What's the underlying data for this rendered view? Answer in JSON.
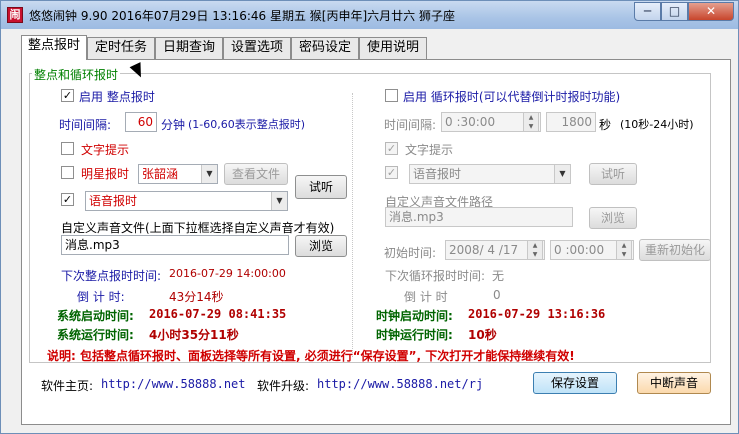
{
  "window": {
    "title": "悠悠闹钟 9.90 2016年07月29日 13:16:46 星期五 猴[丙申年]六月廿六 狮子座",
    "icon_glyph": "闹",
    "controls": {
      "minimize": "─",
      "maximize": "□",
      "close": "✕"
    }
  },
  "tabs": [
    {
      "label": "整点报时",
      "active": true
    },
    {
      "label": "定时任务"
    },
    {
      "label": "日期查询"
    },
    {
      "label": "设置选项"
    },
    {
      "label": "密码设定"
    },
    {
      "label": "使用说明"
    }
  ],
  "group_title": "整点和循环报时",
  "left": {
    "enable_label": "启用 整点报时",
    "enable_checked": "✓",
    "interval_label": "时间间隔:",
    "interval_value": "60",
    "interval_unit": "分钟",
    "interval_hint": "(1-60,60表示整点报时)",
    "text_prompt_label": "文字提示",
    "star_label": "明星报时",
    "star_select": "张韶涵",
    "view_file_label": "查看文件",
    "voice_checked": "✓",
    "voice_select": "语音报时",
    "audition_label": "试听",
    "custom_sound_label": "自定义声音文件(上面下拉框选择自定义声音才有效)",
    "custom_sound_file": "消息.mp3",
    "browse_label": "浏览",
    "next_label": "下次整点报时时间:",
    "next_value": "2016-07-29 14:00:00",
    "countdown_label": "倒 计 时:",
    "countdown_value": "43分14秒",
    "sys_start_label": "系统启动时间:",
    "sys_start_value": "2016-07-29 08:41:35",
    "sys_run_label": "系统运行时间:",
    "sys_run_value": "4小时35分11秒"
  },
  "right": {
    "enable_label": "启用 循环报时(可以代替倒计时报时功能)",
    "interval_label": "时间间隔:",
    "interval_value": "0 :30:00",
    "seconds_value": "1800",
    "seconds_unit": "秒",
    "seconds_hint": "(10秒-24小时)",
    "text_prompt_label": "文字提示",
    "text_prompt_checked": "✓",
    "voice_checked": "✓",
    "voice_select": "语音报时",
    "audition_label": "试听",
    "custom_path_label": "自定义声音文件路径",
    "custom_path_value": "消息.mp3",
    "browse_label": "浏览",
    "init_time_label": "初始时间:",
    "init_date": "2008/ 4 /17",
    "init_time": "0 :00:00",
    "reinit_label": "重新初始化",
    "next_cycle_label": "下次循环报时时间:",
    "next_cycle_value": "无",
    "countdown_label": "倒 计 时",
    "countdown_value": "0",
    "clock_start_label": "时钟启动时间:",
    "clock_start_value": "2016-07-29 13:16:36",
    "clock_run_label": "时钟运行时间:",
    "clock_run_value": "10秒"
  },
  "note": "说明: 包括整点循环报时、面板选择等所有设置, 必须进行“保存设置”, 下次打开才能保持继续有效!",
  "footer": {
    "home_label": "软件主页:",
    "home_url": "http://www.58888.net",
    "upgrade_label": "软件升级:",
    "upgrade_url": "http://www.58888.net/rj",
    "save_label": "保存设置",
    "stop_sound_label": "中断声音"
  }
}
